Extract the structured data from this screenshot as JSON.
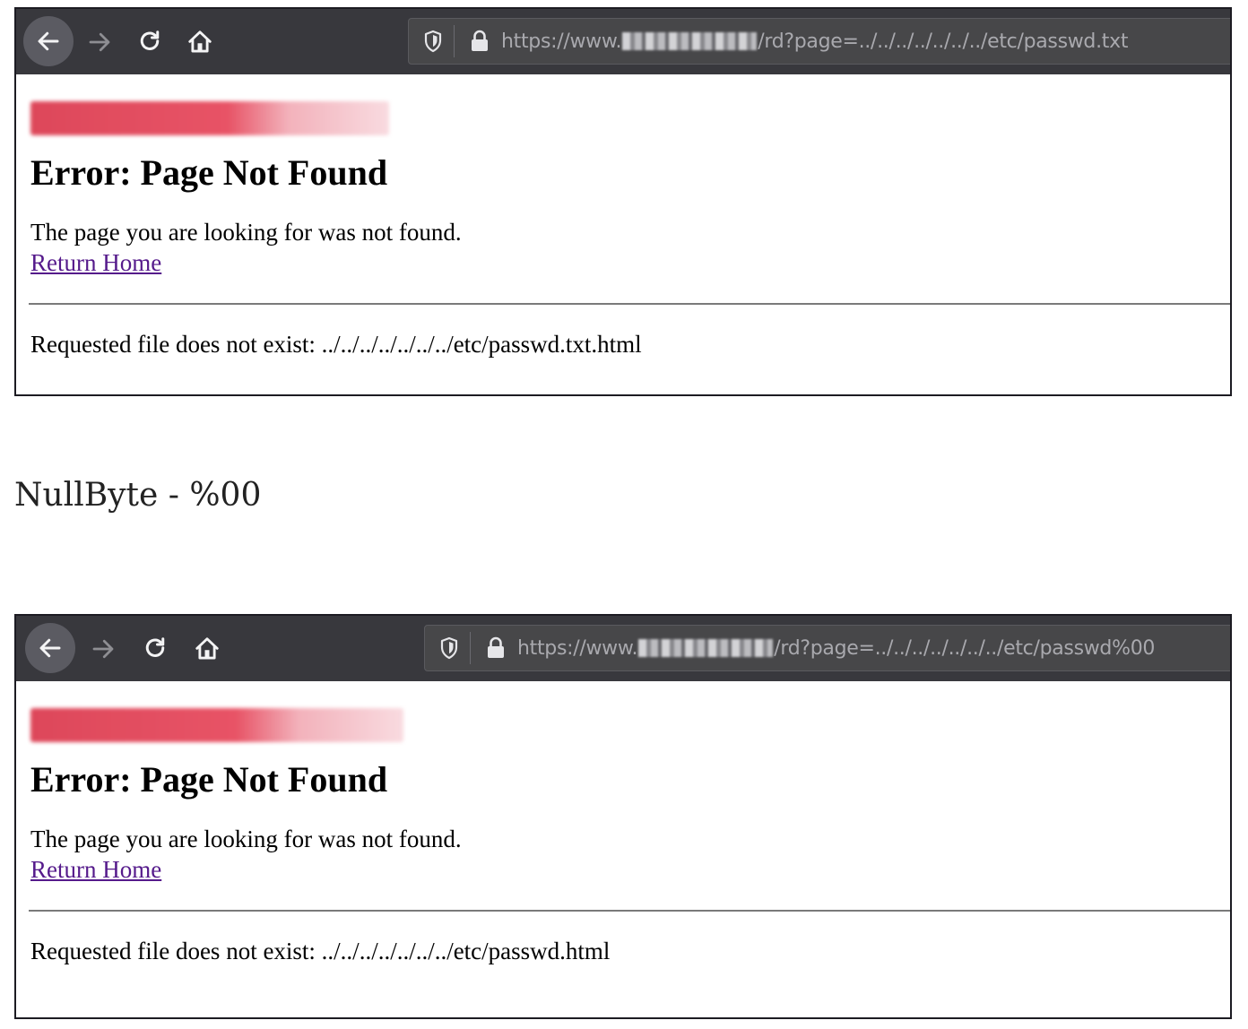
{
  "screenshots": [
    {
      "url": {
        "prefix": "https://www.",
        "suffix": "/rd?page=../../../../../../../etc/passwd.txt"
      },
      "page": {
        "error_title": "Error: Page Not Found",
        "message": "The page you are looking for was not found.",
        "return_link": "Return Home",
        "requested_file": "Requested file does not exist: ../../../../../../../etc/passwd.txt.html"
      }
    },
    {
      "url": {
        "prefix": "https://www.",
        "suffix": "/rd?page=../../../../../../../etc/passwd%00"
      },
      "page": {
        "error_title": "Error: Page Not Found",
        "message": "The page you are looking for was not found.",
        "return_link": "Return Home",
        "requested_file": "Requested file does not exist: ../../../../../../../etc/passwd.html"
      }
    }
  ],
  "caption": "NullByte - %00",
  "icons": {
    "back": "back-arrow-icon",
    "forward": "forward-arrow-icon",
    "reload": "reload-icon",
    "home": "home-icon",
    "tracking": "shield-icon",
    "security": "lock-icon"
  },
  "colors": {
    "toolbar_bg": "#38383d",
    "urlbar_bg": "#474749",
    "visited_link": "#551a8b",
    "logo_red": "#d8283e"
  }
}
